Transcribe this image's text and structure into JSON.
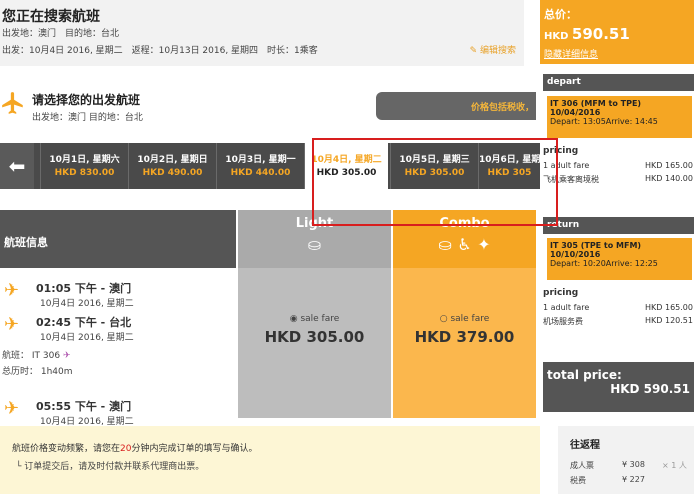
{
  "search": {
    "title": "您正在搜索航班",
    "line1": "出发地：澳门　目的地：台北",
    "line2": "出发：10月4日 2016, 星期二　返程：10月13日 2016, 星期四　时长：1乘客",
    "edit": "编辑搜索"
  },
  "choose": {
    "title": "请选择您的出发航班",
    "sub": "出发地：澳门 目的地：台北",
    "price_button": "价格包括税收，"
  },
  "date_tabs": [
    {
      "date": "10月1日, 星期六",
      "price": "HKD 830.00"
    },
    {
      "date": "10月2日, 星期日",
      "price": "HKD 490.00"
    },
    {
      "date": "10月3日, 星期一",
      "price": "HKD 440.00"
    },
    {
      "date": "10月4日, 星期二",
      "price": "HKD 305.00"
    },
    {
      "date": "10月5日, 星期三",
      "price": "HKD 305.00"
    },
    {
      "date": "10月6日, 星期四",
      "price": "HKD 305"
    }
  ],
  "table": {
    "info_header": "航班信息",
    "light_header": "Light",
    "combo_header": "Combo",
    "light_radio": "sale fare",
    "light_price": "HKD 305.00",
    "combo_radio": "sale fare",
    "combo_price": "HKD 379.00"
  },
  "flight": {
    "dep_time": "01:05 下午 - 澳门",
    "dep_date": "10月4日 2016, 星期二",
    "arr_time": "02:45 下午 - 台北",
    "arr_date": "10月4日 2016, 星期二",
    "flight_no": "航班：  IT 306",
    "duration": "总历时：  1h40m",
    "next_time": "05:55 下午 - 澳门",
    "next_date": "10月4日 2016, 星期二"
  },
  "summary": {
    "total_label": "总价：",
    "currency": "HKD",
    "total": "590.51",
    "details_link": "隐藏详细信息",
    "depart_label": "depart",
    "depart_flight": "IT 306 (MFM to TPE)",
    "depart_date": "10/04/2016",
    "depart_times": "Depart: 13:05Arrive: 14:45",
    "return_label": "return",
    "return_flight": "IT 305 (TPE to MFM)",
    "return_date": "10/10/2016",
    "return_times": "Depart: 10:20Arrive: 12:25",
    "pricing1": "pricing",
    "fare1_label": "1 adult fare",
    "fare1_value": "HKD 165.00",
    "tax1_label": "飞机乘客离境税",
    "tax1_value": "HKD 140.00",
    "pricing2": "pricing",
    "fare2_label": "1 adult fare",
    "fare2_value": "HKD 165.00",
    "tax2_label": "机场服务费",
    "tax2_value": "HKD 120.51",
    "total_price_label": "total price:",
    "total_price_value": "HKD 590.51"
  },
  "warning": {
    "line1_pre": "航班价格变动频繁，请您在",
    "line1_num": "20",
    "line1_post": "分钟内完成订单的填写与确认。",
    "line2": "└ 订单提交后，请及时付款并联系代理商出票。"
  },
  "roundtrip": {
    "title": "往返程",
    "adult_label": "成人票",
    "adult_value": "¥ 308",
    "adult_mult": "× 1 人",
    "tax_label": "税费",
    "tax_value": "¥ 227"
  }
}
